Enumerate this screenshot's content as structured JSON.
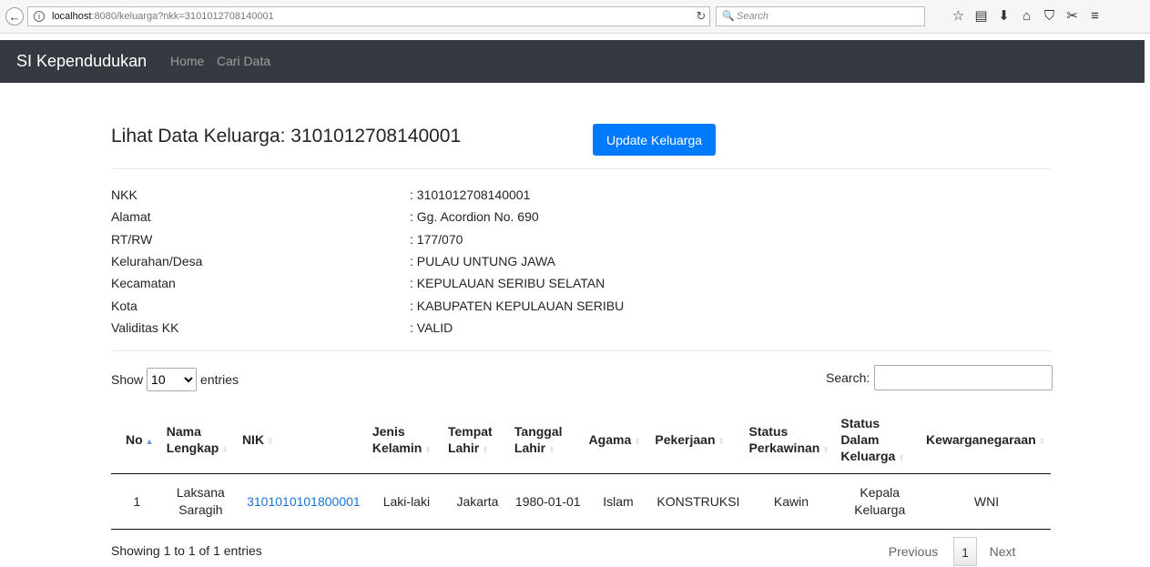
{
  "browser": {
    "url_host": "localhost",
    "url_path": ":8080/keluarga?nkk=3101012708140001",
    "search_placeholder": "Search",
    "search_glyph": "🔍",
    "back_glyph": "←",
    "info_glyph": "i",
    "reload_glyph": "↻"
  },
  "navbar": {
    "brand": "SI Kependudukan",
    "links": [
      "Home",
      "Cari Data"
    ]
  },
  "page": {
    "title": "Lihat Data Keluarga: 3101012708140001",
    "update_button": "Update Keluarga"
  },
  "family_info": [
    {
      "label": "NKK",
      "value": ": 3101012708140001"
    },
    {
      "label": "Alamat",
      "value": ": Gg. Acordion No. 690"
    },
    {
      "label": "RT/RW",
      "value": ": 177/070"
    },
    {
      "label": "Kelurahan/Desa",
      "value": ": PULAU UNTUNG JAWA"
    },
    {
      "label": "Kecamatan",
      "value": ": KEPULAUAN SERIBU SELATAN"
    },
    {
      "label": "Kota",
      "value": ": KABUPATEN KEPULAUAN SERIBU"
    },
    {
      "label": "Validitas KK",
      "value": ": VALID"
    }
  ],
  "table_controls": {
    "show_label": "Show",
    "length_value": "10",
    "entries_label": "entries",
    "search_label": "Search:"
  },
  "table": {
    "headers": [
      "No",
      "Nama Lengkap",
      "NIK",
      "Jenis Kelamin",
      "Tempat Lahir",
      "Tanggal Lahir",
      "Agama",
      "Pekerjaan",
      "Status Perkawinan",
      "Status Dalam Keluarga",
      "Kewarganegaraan"
    ],
    "rows": [
      [
        "1",
        "Laksana Saragih",
        "3101010101800001",
        "Laki-laki",
        "Jakarta",
        "1980-01-01",
        "Islam",
        "KONSTRUKSI",
        "Kawin",
        "Kepala Keluarga",
        "WNI"
      ]
    ]
  },
  "footer": {
    "info": "Showing 1 to 1 of 1 entries",
    "previous": "Previous",
    "current_page": "1",
    "next": "Next"
  }
}
